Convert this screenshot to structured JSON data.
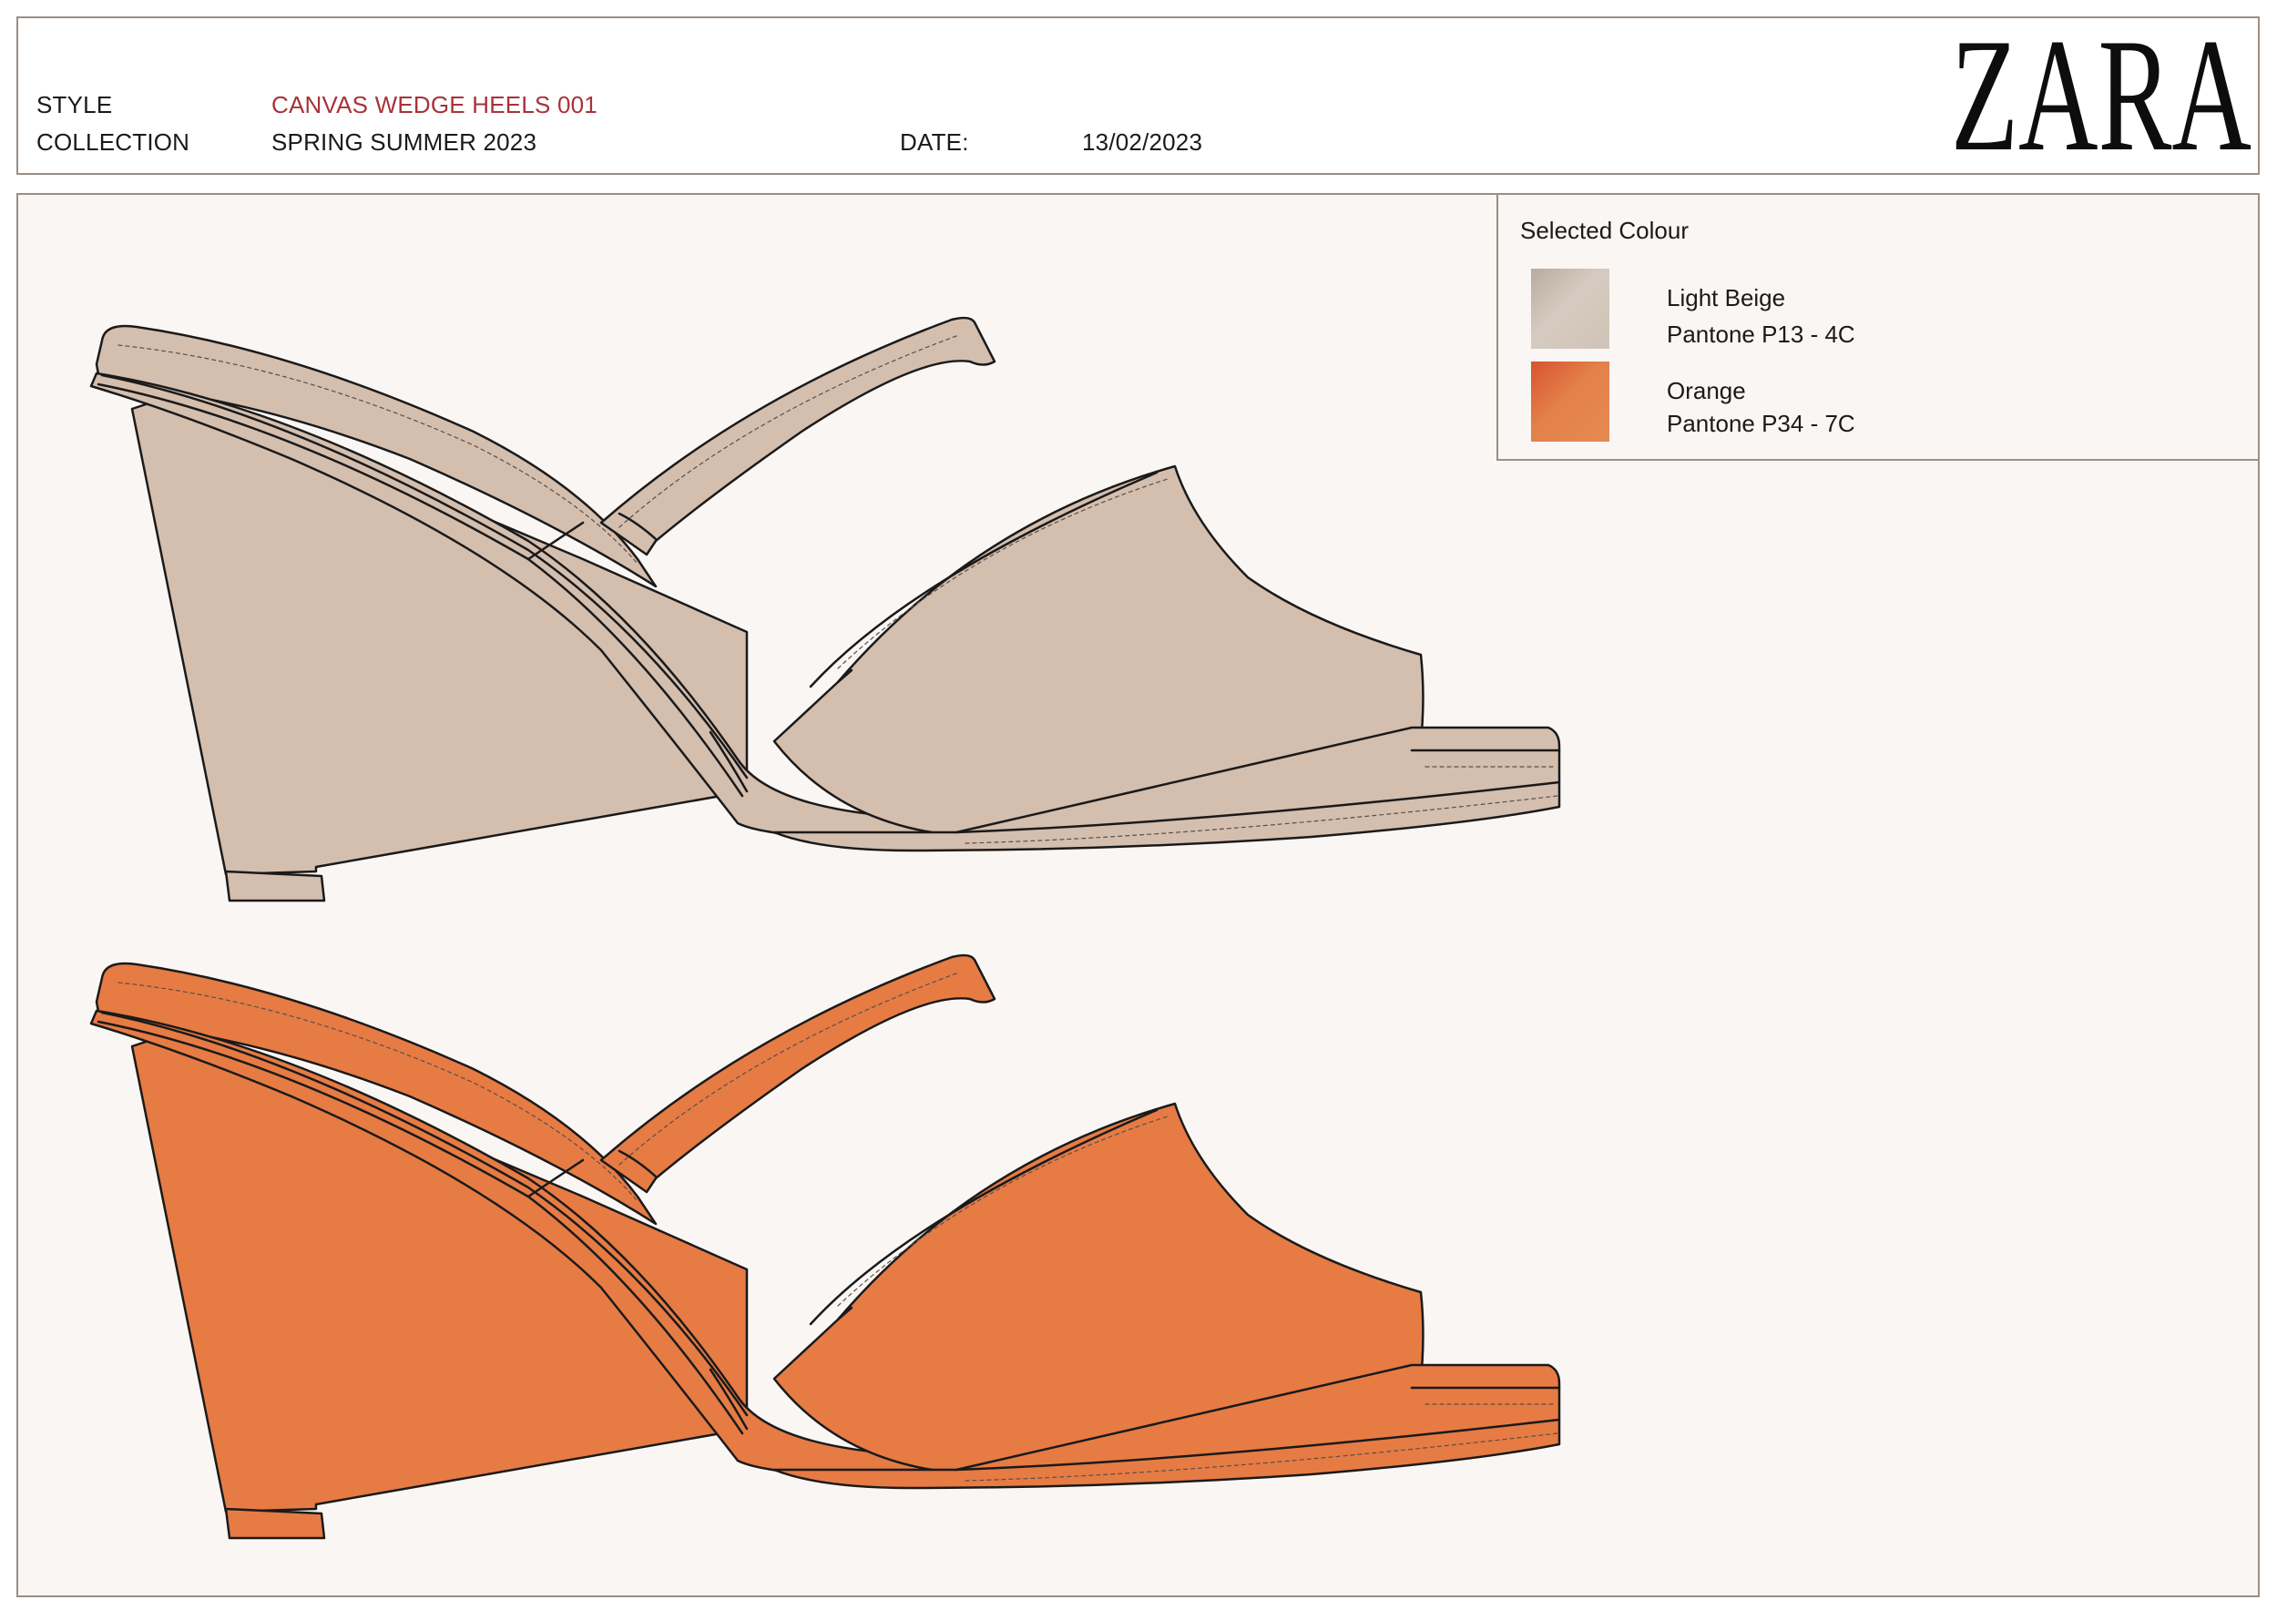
{
  "header": {
    "style_label": "STYLE",
    "style_value": "CANVAS WEDGE HEELS 001",
    "collection_label": "COLLECTION",
    "collection_value": "SPRING SUMMER 2023",
    "date_label": "DATE:",
    "date_value": "13/02/2023",
    "brand": "ZARA"
  },
  "colour_panel": {
    "title": "Selected Colour",
    "colours": [
      {
        "name": "Light Beige",
        "pantone": "Pantone P13 - 4C",
        "hex": "#D4BEAE"
      },
      {
        "name": "Orange",
        "pantone": "Pantone P34 - 7C",
        "hex": "#E67B44"
      }
    ]
  },
  "drawings": [
    {
      "name": "beige-wedge-sandal",
      "fill": "#D4BEAE"
    },
    {
      "name": "orange-wedge-sandal",
      "fill": "#E67B44"
    }
  ],
  "colors": {
    "border": "#9A8F86",
    "accent_red": "#A8323A",
    "sheet_bg": "#F9F6F3"
  }
}
